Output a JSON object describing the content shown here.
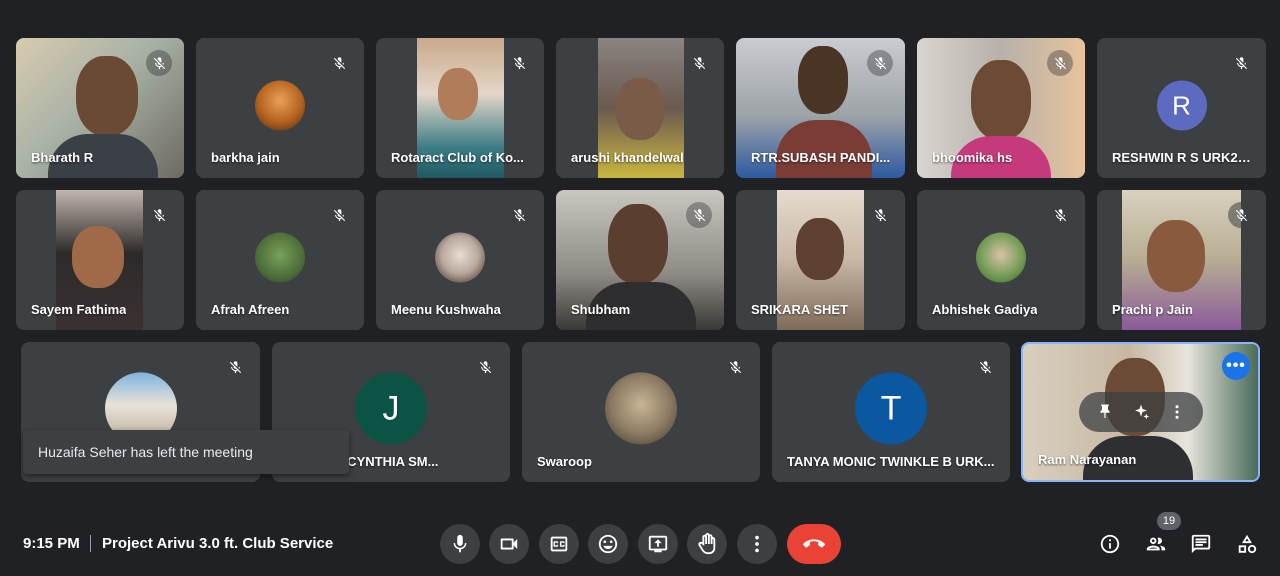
{
  "participants": [
    {
      "name": "Bharath R",
      "kind": "video"
    },
    {
      "name": "barkha jain",
      "kind": "avatar"
    },
    {
      "name": "Rotaract Club of Ko...",
      "kind": "video"
    },
    {
      "name": "arushi khandelwal",
      "kind": "video"
    },
    {
      "name": "RTR.SUBASH PANDI...",
      "kind": "video"
    },
    {
      "name": "bhoomika hs",
      "kind": "video"
    },
    {
      "name": "RESHWIN R S URK22...",
      "kind": "initial",
      "initial": "R",
      "color": "#5c6bc0"
    },
    {
      "name": "Sayem Fathima",
      "kind": "video"
    },
    {
      "name": "Afrah Afreen",
      "kind": "avatar"
    },
    {
      "name": "Meenu Kushwaha",
      "kind": "avatar"
    },
    {
      "name": "Shubham",
      "kind": "video"
    },
    {
      "name": "SRIKARA SHET",
      "kind": "video"
    },
    {
      "name": "Abhishek Gadiya",
      "kind": "avatar"
    },
    {
      "name": "Prachi p Jain",
      "kind": "video"
    },
    {
      "name": "",
      "kind": "avatar"
    },
    {
      "name": "AGADDA CYNTHIA SM...",
      "kind": "initial",
      "initial": "J",
      "color": "#0b5345"
    },
    {
      "name": "Swaroop",
      "kind": "avatar"
    },
    {
      "name": "TANYA MONIC TWINKLE B URK...",
      "kind": "initial",
      "initial": "T",
      "color": "#0b57a0"
    },
    {
      "name": "Ram Narayanan",
      "kind": "self"
    }
  ],
  "toast": "Huzaifa Seher has left the meeting",
  "footer": {
    "time": "9:15 PM",
    "meeting_title": "Project Arivu 3.0 ft. Club Service",
    "participant_count": "19"
  },
  "colors": {
    "background": "#202124",
    "tile": "#3c4043",
    "end_call": "#ea4335",
    "accent": "#8ab4f8"
  }
}
